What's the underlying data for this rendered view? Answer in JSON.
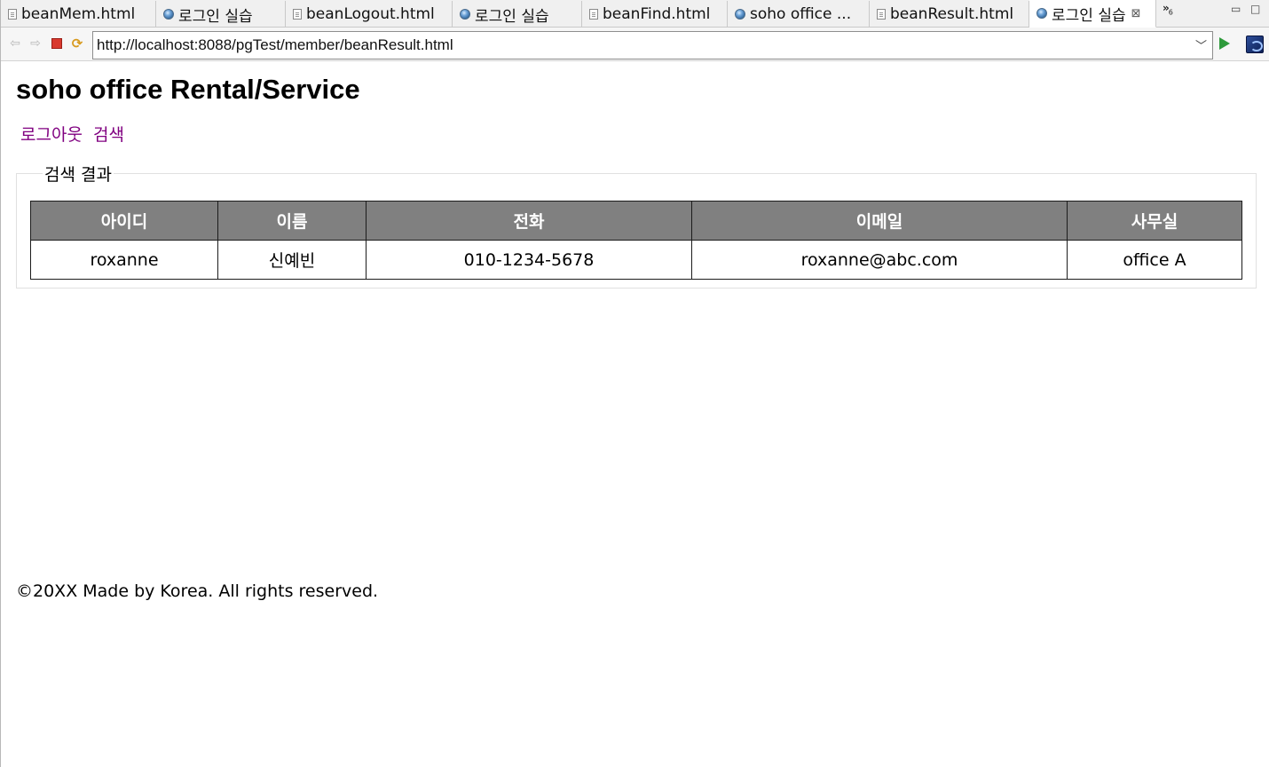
{
  "tabs": [
    {
      "label": "beanMem.html",
      "icon": "file-icon"
    },
    {
      "label": "로그인 실습",
      "icon": "globe-icon"
    },
    {
      "label": "beanLogout.html",
      "icon": "file-icon"
    },
    {
      "label": "로그인 실습",
      "icon": "globe-icon"
    },
    {
      "label": "beanFind.html",
      "icon": "file-icon"
    },
    {
      "label": "soho office ...",
      "icon": "globe-icon"
    },
    {
      "label": "beanResult.html",
      "icon": "file-icon"
    },
    {
      "label": "로그인 실습",
      "icon": "globe-icon",
      "active": true,
      "close": "⊠"
    }
  ],
  "tab_overflow": {
    "glyph": "»",
    "count": "6"
  },
  "address_bar": {
    "url": "http://localhost:8088/pgTest/member/beanResult.html"
  },
  "page": {
    "title": "soho office Rental/Service",
    "links": [
      "로그아웃",
      "검색"
    ],
    "link_color": "#800080",
    "results_legend": "검색 결과",
    "table": {
      "headers": [
        "아이디",
        "이름",
        "전화",
        "이메일",
        "사무실"
      ],
      "header_bg": "#808080",
      "rows": [
        [
          "roxanne",
          "신예빈",
          "010-1234-5678",
          "roxanne@abc.com",
          "office A"
        ]
      ]
    },
    "footer": "©20XX Made by Korea. All rights reserved."
  }
}
